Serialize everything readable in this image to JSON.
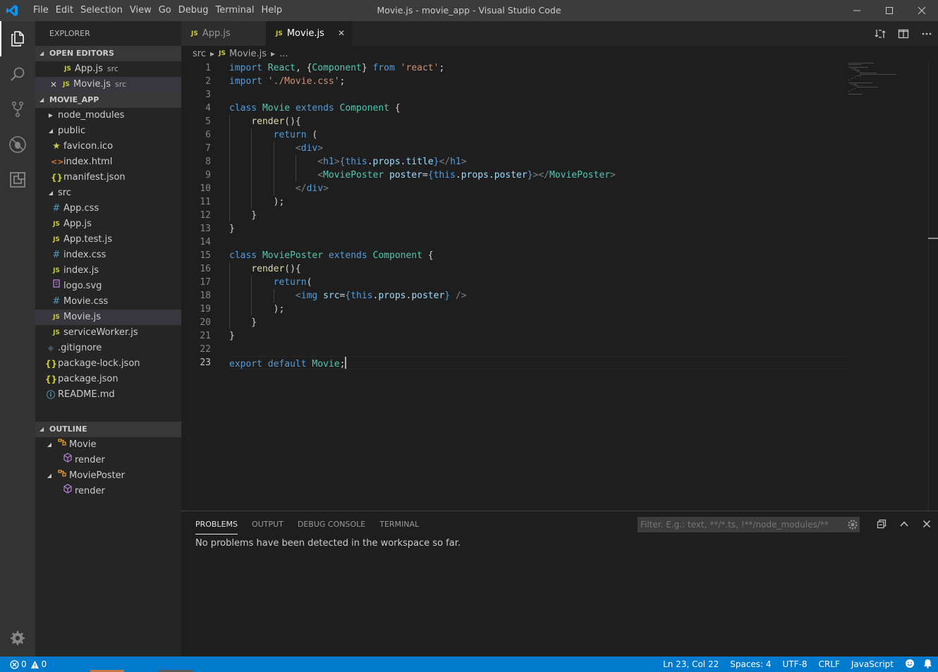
{
  "window": {
    "title": "Movie.js - movie_app - Visual Studio Code",
    "menu": [
      "File",
      "Edit",
      "Selection",
      "View",
      "Go",
      "Debug",
      "Terminal",
      "Help"
    ]
  },
  "activity_bar": [
    "files-icon",
    "search-icon",
    "source-control-icon",
    "debug-icon",
    "extensions-icon",
    "settings-gear-icon"
  ],
  "sidebar": {
    "title": "EXPLORER",
    "open_editors": {
      "header": "OPEN EDITORS",
      "items": [
        {
          "icon": "JS",
          "name": "App.js",
          "desc": "src"
        },
        {
          "icon": "JS",
          "name": "Movie.js",
          "desc": "src"
        }
      ]
    },
    "project": {
      "header": "MOVIE_APP",
      "items": [
        {
          "name": "node_modules"
        },
        {
          "name": "public"
        },
        {
          "icon": "★",
          "name": "favicon.ico"
        },
        {
          "icon": "<>",
          "name": "index.html"
        },
        {
          "icon": "{}",
          "name": "manifest.json"
        },
        {
          "name": "src"
        },
        {
          "icon": "#",
          "name": "App.css"
        },
        {
          "icon": "JS",
          "name": "App.js"
        },
        {
          "icon": "JS",
          "name": "App.test.js"
        },
        {
          "icon": "#",
          "name": "index.css"
        },
        {
          "icon": "JS",
          "name": "index.js"
        },
        {
          "name": "logo.svg"
        },
        {
          "icon": "#",
          "name": "Movie.css"
        },
        {
          "icon": "JS",
          "name": "Movie.js"
        },
        {
          "icon": "JS",
          "name": "serviceWorker.js"
        },
        {
          "icon": "◆",
          "name": ".gitignore"
        },
        {
          "icon": "{}",
          "name": "package-lock.json"
        },
        {
          "icon": "{}",
          "name": "package.json"
        },
        {
          "icon": "ⓘ",
          "name": "README.md"
        }
      ]
    },
    "outline": {
      "header": "OUTLINE",
      "items": [
        {
          "name": "Movie"
        },
        {
          "name": "render"
        },
        {
          "name": "MoviePoster"
        },
        {
          "name": "render"
        }
      ]
    }
  },
  "tabs": [
    {
      "icon": "JS",
      "label": "App.js",
      "active": false
    },
    {
      "icon": "JS",
      "label": "Movie.js",
      "active": true
    }
  ],
  "breadcrumbs": {
    "folder": "src",
    "icon": "JS",
    "file": "Movie.js",
    "symbol": "..."
  },
  "editor": {
    "line_numbers": [
      "1",
      "2",
      "3",
      "4",
      "5",
      "6",
      "7",
      "8",
      "9",
      "10",
      "11",
      "12",
      "13",
      "14",
      "15",
      "16",
      "17",
      "18",
      "19",
      "20",
      "21",
      "22",
      "23"
    ],
    "lines": [
      "import React, {Component} from 'react';",
      "import './Movie.css';",
      "",
      "class Movie extends Component {",
      "    render(){",
      "        return (",
      "            <div>",
      "                <h1>{this.props.title}</h1>",
      "                <MoviePoster poster={this.props.poster}></MoviePoster>",
      "            </div>",
      "        );",
      "    }",
      "}",
      "",
      "class MoviePoster extends Component {",
      "    render(){",
      "        return(",
      "            <img src={this.props.poster} />",
      "        );",
      "    }",
      "}",
      "",
      "export default Movie;"
    ]
  },
  "panel": {
    "tabs": [
      "PROBLEMS",
      "OUTPUT",
      "DEBUG CONSOLE",
      "TERMINAL"
    ],
    "filter_placeholder": "Filter. E.g.: text, **/*.ts, !**/node_modules/**",
    "message": "No problems have been detected in the workspace so far."
  },
  "status_bar": {
    "errors": "0",
    "warnings": "0",
    "position": "Ln 23, Col 22",
    "indent": "Spaces: 4",
    "encoding": "UTF-8",
    "eol": "CRLF",
    "language": "JavaScript"
  },
  "colors": {
    "status_bar": "#007acc",
    "accent_js": "#cbcb41"
  }
}
